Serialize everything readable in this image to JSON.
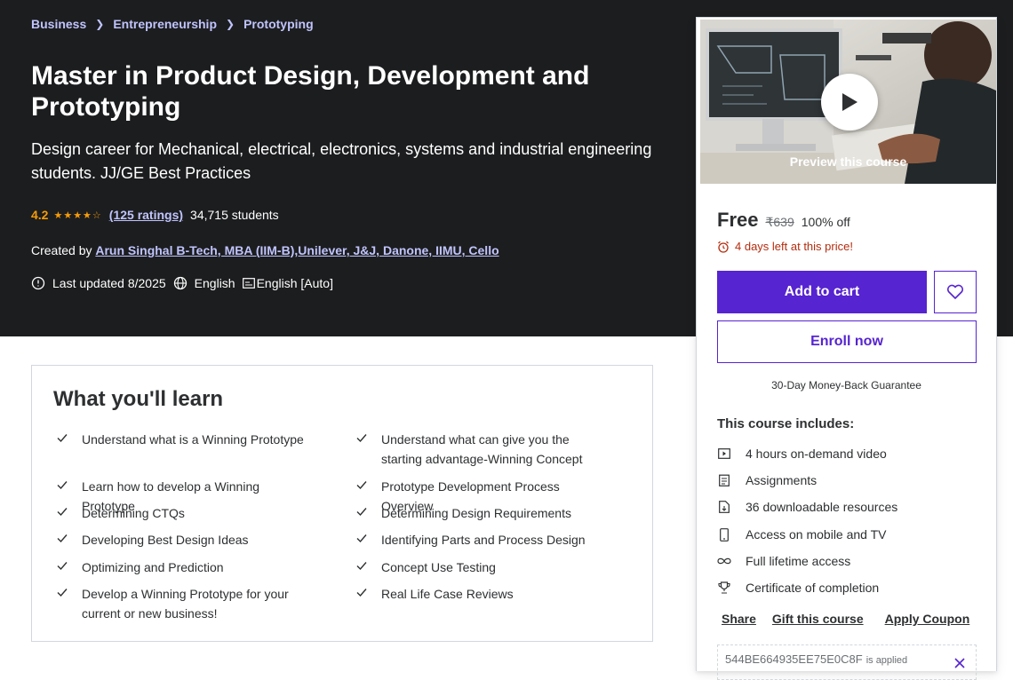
{
  "breadcrumb": [
    "Business",
    "Entrepreneurship",
    "Prototyping"
  ],
  "course": {
    "title": "Master in Product Design, Development and Prototyping",
    "subtitle": "Design career for Mechanical, electrical, electronics, systems and industrial engineering students. JJ/GE Best Practices",
    "rating": "4.2",
    "rating_value": 4.2,
    "ratings_link": "(125 ratings)",
    "students": "34,715 students",
    "created_by_label": "Created by",
    "instructor": "Arun Singhal B-Tech, MBA (IIM-B),Unilever, J&J, Danone, IIMU, Cello",
    "last_updated": "Last updated 8/2025",
    "language": "English",
    "captions": "English [Auto]"
  },
  "learn": {
    "title": "What you'll learn",
    "left": [
      "Understand what is a Winning Prototype",
      "Learn how to develop a Winning Prototype",
      "Determining CTQs",
      "Developing Best Design Ideas",
      "Optimizing and Prediction",
      "Develop a Winning Prototype for your current or new business!"
    ],
    "right": [
      "Understand what can give you the starting advantage-Winning Concept",
      "Prototype Development Process Overview",
      "Determining Design Requirements",
      "Identifying Parts and Process Design",
      "Concept Use Testing",
      "Real Life Case Reviews"
    ]
  },
  "sidebar": {
    "preview_label": "Preview this course",
    "price": "Free",
    "original_price": "₹639",
    "discount": "100% off",
    "countdown": "4 days left at this price!",
    "add_to_cart": "Add to cart",
    "enroll": "Enroll now",
    "guarantee": "30-Day Money-Back Guarantee",
    "includes_title": "This course includes:",
    "includes": [
      {
        "icon": "video-icon",
        "label": "4 hours on-demand video"
      },
      {
        "icon": "assignment-icon",
        "label": "Assignments"
      },
      {
        "icon": "download-icon",
        "label": "36 downloadable resources"
      },
      {
        "icon": "mobile-icon",
        "label": "Access on mobile and TV"
      },
      {
        "icon": "infinity-icon",
        "label": "Full lifetime access"
      },
      {
        "icon": "trophy-icon",
        "label": "Certificate of completion"
      }
    ],
    "share": "Share",
    "gift": "Gift this course",
    "apply_coupon": "Apply Coupon",
    "coupon_code": "544BE664935EE75E0C8F",
    "coupon_applied": "is applied"
  },
  "colors": {
    "hero_bg": "#1c1d1f",
    "accent": "#5624d0",
    "link": "#c0c4fc",
    "star": "#f69c08",
    "alert": "#b32d0f"
  }
}
